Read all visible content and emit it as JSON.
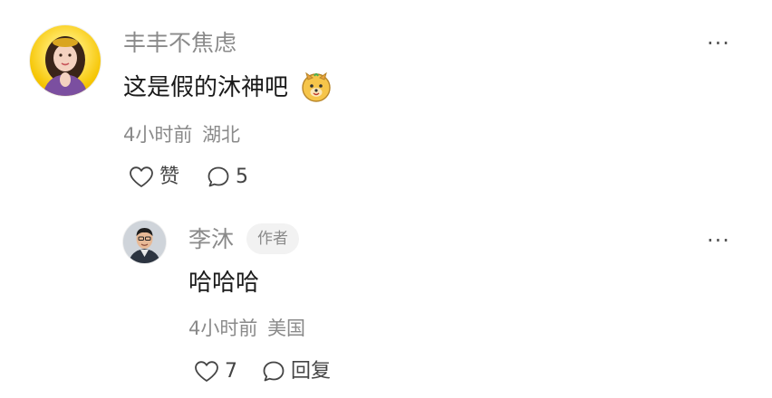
{
  "comment": {
    "author": "丰丰不焦虑",
    "text": "这是假的沐神吧",
    "emoji": "happy-dog-emoji",
    "time": "4小时前",
    "location": "湖北",
    "like_label": "赞",
    "reply_count": "5",
    "more_label": "···"
  },
  "reply": {
    "author": "李沐",
    "badge": "作者",
    "text": "哈哈哈",
    "time": "4小时前",
    "location": "美国",
    "like_count": "7",
    "reply_label": "回复",
    "more_label": "···"
  },
  "colors": {
    "secondary_text": "#8a8a8a",
    "primary_text": "#1a1a1a",
    "badge_bg": "#f2f2f2"
  }
}
